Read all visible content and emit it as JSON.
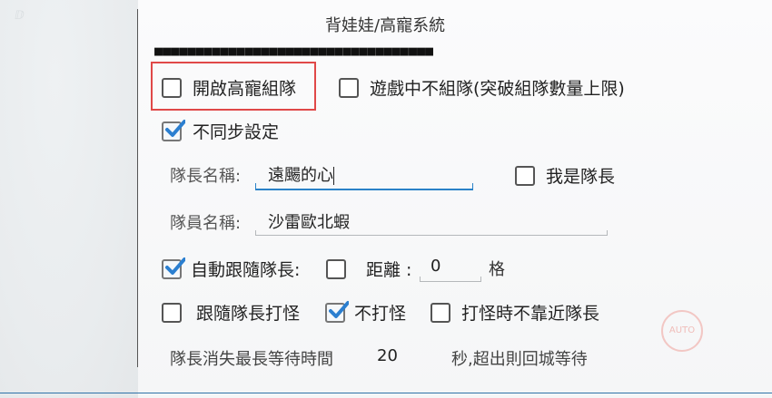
{
  "title": "背娃娃/高寵系統",
  "progress_blocks": "■■■■■■■■■■■■■■■■■■■■■■■■■■■■■■■■■■",
  "options": {
    "open_pet_team": {
      "label": "開啟高寵組隊",
      "checked": false
    },
    "no_team_in_game": {
      "label": "遊戲中不組隊(突破組隊數量上限)",
      "checked": false
    },
    "no_sync_settings": {
      "label": "不同步設定",
      "checked": true
    },
    "i_am_leader": {
      "label": "我是隊長",
      "checked": false
    },
    "auto_follow_leader": {
      "label": "自動跟隨隊長:",
      "checked": true
    },
    "distance": {
      "label": "距離 :",
      "checked": false
    },
    "follow_and_fight": {
      "label": "跟隨隊長打怪",
      "checked": false
    },
    "no_fight": {
      "label": "不打怪",
      "checked": true
    },
    "no_approach_when_fight": {
      "label": "打怪時不靠近隊長",
      "checked": false
    }
  },
  "leader_name": {
    "label": "隊長名稱:",
    "value": "遠颺的心"
  },
  "member_name": {
    "label": "隊員名稱:",
    "value": "沙雷歐北蝦"
  },
  "distance_value": "0",
  "distance_unit": "格",
  "wait": {
    "label": "隊長消失最長等待時間",
    "value": "20",
    "suffix": "秒,超出則回城等待"
  },
  "colors": {
    "accent": "#2a82c8",
    "highlight": "#e04848",
    "check": "#2b7fd0"
  },
  "auto_badge": "AUTO"
}
